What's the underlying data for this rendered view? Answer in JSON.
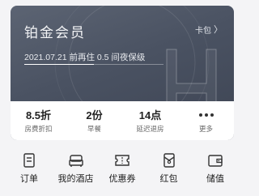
{
  "membership": {
    "title": "铂金会员",
    "wallet_label": "卡包",
    "wallet_chevron": "〉",
    "progress_text": "2021.07.21 前再住 0.5 间夜保级",
    "progress": 0.5
  },
  "perks": [
    {
      "value": "8.5折",
      "label": "房费折扣"
    },
    {
      "value": "2份",
      "label": "早餐"
    },
    {
      "value": "14点",
      "label": "延迟退房"
    },
    {
      "value": "",
      "label": "更多",
      "icon": "more-dots-icon"
    }
  ],
  "nav": [
    {
      "label": "订单",
      "icon": "order-icon"
    },
    {
      "label": "我的酒店",
      "icon": "bed-icon"
    },
    {
      "label": "优惠券",
      "icon": "coupon-icon"
    },
    {
      "label": "红包",
      "icon": "red-envelope-icon"
    },
    {
      "label": "储值",
      "icon": "wallet-icon"
    }
  ],
  "colors": {
    "card": "#4a5262",
    "card_text": "#f2f3f5",
    "page_bg": "#f4f4f6"
  }
}
